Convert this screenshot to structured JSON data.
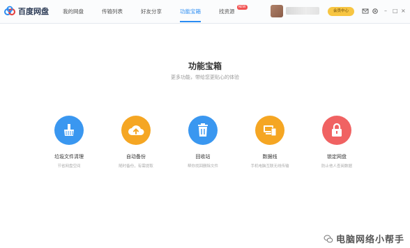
{
  "app": {
    "name": "百度网盘"
  },
  "nav": [
    {
      "label": "我的网盘"
    },
    {
      "label": "传输列表"
    },
    {
      "label": "好友分享"
    },
    {
      "label": "功能宝箱"
    },
    {
      "label": "找资源",
      "badge": "NEW"
    }
  ],
  "header": {
    "vip_label": "会员中心"
  },
  "main": {
    "title": "功能宝箱",
    "subtitle": "更多功能，带给您更贴心的体验"
  },
  "tools": [
    {
      "name": "垃圾文件清理",
      "desc": "节省网盘空间",
      "color": "#3a97f0",
      "icon": "broom-icon"
    },
    {
      "name": "自动备份",
      "desc": "随时备份，有需提取",
      "color": "#f5a623",
      "icon": "cloud-upload-icon"
    },
    {
      "name": "回收站",
      "desc": "帮你找回删除文件",
      "color": "#3a97f0",
      "icon": "trash-icon"
    },
    {
      "name": "数据线",
      "desc": "手机电脑互联无线传输",
      "color": "#f5a623",
      "icon": "devices-icon"
    },
    {
      "name": "锁定网盘",
      "desc": "防止他人查阅数据",
      "color": "#f06262",
      "icon": "lock-icon"
    }
  ],
  "watermark": {
    "text": "电脑网络小帮手"
  },
  "colors": {
    "accent": "#2a8cf2",
    "vip": "#f7c542",
    "badge": "#f25252"
  }
}
